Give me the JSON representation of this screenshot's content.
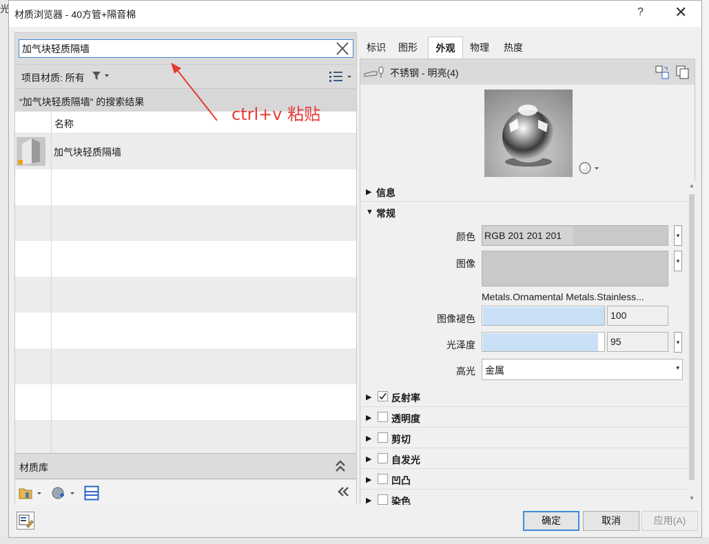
{
  "background": {
    "left_edge_text": "光"
  },
  "window": {
    "title": "材质浏览器 - 40方管+隔音棉",
    "help": "?",
    "close": "✕"
  },
  "left": {
    "search_value": "加气块轻质隔墙",
    "filter_label": "项目材质: 所有",
    "results_header": "“加气块轻质隔墙” 的搜索结果",
    "column_name": "名称",
    "rows": [
      {
        "name": "加气块轻质隔墙"
      }
    ],
    "library_label": "材质库"
  },
  "annotation": {
    "text": "ctrl+v 粘贴"
  },
  "tabs": [
    "标识",
    "图形",
    "外观",
    "物理",
    "热度"
  ],
  "active_tab": "外观",
  "asset": {
    "name": "不锈钢 - 明亮(4)"
  },
  "sections": {
    "info": "信息",
    "general": "常规",
    "reflectivity": "反射率",
    "transparency": "透明度",
    "cutout": "剪切",
    "self_illum": "自发光",
    "bump": "凹凸",
    "tint": "染色"
  },
  "props": {
    "color_label": "颜色",
    "color_value": "RGB 201 201 201",
    "image_label": "图像",
    "image_path": "Metals.Ornamental Metals.Stainless...",
    "fade_label": "图像褪色",
    "fade_value": "100",
    "gloss_label": "光泽度",
    "gloss_value": "95",
    "highlight_label": "高光",
    "highlight_value": "金属"
  },
  "buttons": {
    "ok": "确定",
    "cancel": "取消",
    "apply": "应用(A)"
  },
  "colors": {
    "accent": "#3b8ad9",
    "annotation": "#e53935",
    "color_swatch": "#c9c9c9",
    "slider_fill": "#c9e0f6"
  },
  "levels": {
    "image_fade": 100,
    "glossiness": 95
  }
}
